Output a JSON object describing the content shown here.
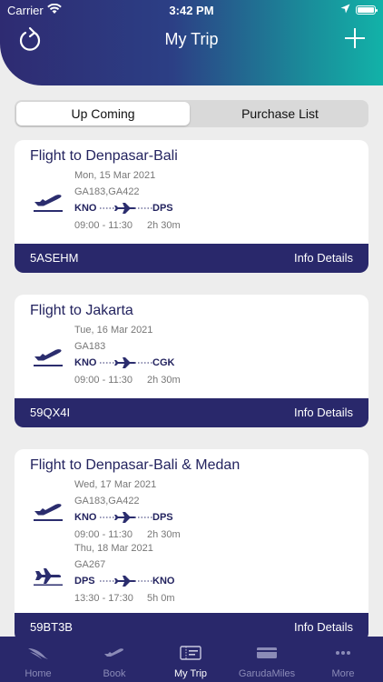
{
  "status_bar": {
    "carrier": "Carrier",
    "time": "3:42 PM"
  },
  "header": {
    "title": "My Trip",
    "refresh_icon": "refresh-icon",
    "add_icon": "plus-icon"
  },
  "tabs": {
    "upcoming": "Up Coming",
    "purchase": "Purchase List",
    "selected": "Up Coming"
  },
  "colors": {
    "primary": "#29286b",
    "accent": "#12b2a8",
    "background": "#ededed"
  },
  "trips": [
    {
      "title": "Flight to Denpasar-Bali",
      "booking_code": "5ASEHM",
      "info_label": "Info Details",
      "segments": [
        {
          "date": "Mon, 15 Mar 2021",
          "flight_numbers": "GA183,GA422",
          "origin": "KNO",
          "destination": "DPS",
          "time": "09:00 - 11:30",
          "duration": "2h 30m"
        }
      ]
    },
    {
      "title": "Flight to Jakarta",
      "booking_code": "59QX4I",
      "info_label": "Info Details",
      "segments": [
        {
          "date": "Tue, 16 Mar 2021",
          "flight_numbers": "GA183",
          "origin": "KNO",
          "destination": "CGK",
          "time": "09:00 - 11:30",
          "duration": "2h 30m"
        }
      ]
    },
    {
      "title": "Flight to Denpasar-Bali & Medan",
      "booking_code": "59BT3B",
      "info_label": "Info Details",
      "segments": [
        {
          "date": "Wed, 17 Mar 2021",
          "flight_numbers": "GA183,GA422",
          "origin": "KNO",
          "destination": "DPS",
          "time": "09:00 - 11:30",
          "duration": "2h 30m"
        },
        {
          "date": "Thu, 18 Mar 2021",
          "flight_numbers": "GA267",
          "origin": "DPS",
          "destination": "KNO",
          "time": "13:30 - 17:30",
          "duration": "5h 0m"
        }
      ]
    }
  ],
  "tabbar": [
    {
      "label": "Home",
      "icon": "garuda-logo-icon"
    },
    {
      "label": "Book",
      "icon": "plane-icon"
    },
    {
      "label": "My Trip",
      "icon": "boarding-pass-icon",
      "active": true
    },
    {
      "label": "GarudaMiles",
      "icon": "miles-card-icon"
    },
    {
      "label": "More",
      "icon": "more-dots-icon"
    }
  ]
}
